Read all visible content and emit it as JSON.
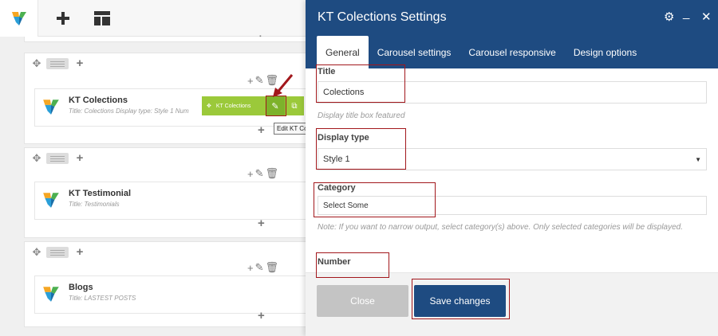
{
  "toolbar": {
    "add_label": "+",
    "layout_label": "layout"
  },
  "editor": {
    "row_add": "+",
    "col_tools": "+",
    "elements": [
      {
        "title": "KT Colections",
        "subtitle": "Title: Colections  Display type: Style 1  Num"
      },
      {
        "title": "KT Testimonial",
        "subtitle": "Title: Testimonials"
      },
      {
        "title": "Blogs",
        "subtitle": "Title: LASTEST POSTS"
      }
    ],
    "element_toolbar_label": "KT Colections",
    "tooltip": "Edit KT Colections"
  },
  "panel": {
    "title": "KT Colections Settings",
    "tabs": [
      "General",
      "Carousel settings",
      "Carousel responsive",
      "Design options"
    ],
    "active_tab": "General",
    "fields": {
      "title_label": "Title",
      "title_value": "Colections",
      "title_help": "Display title box featured",
      "display_type_label": "Display type",
      "display_type_value": "Style 1",
      "category_label": "Category",
      "category_placeholder": "Select Some",
      "category_help": "Note: If you want to narrow output, select category(s) above. Only selected categories will be displayed.",
      "number_label": "Number"
    },
    "buttons": {
      "close": "Close",
      "save": "Save changes"
    }
  },
  "colors": {
    "header": "#1e4b81",
    "accent_green": "#9bc93a",
    "highlight": "#a2171c"
  }
}
